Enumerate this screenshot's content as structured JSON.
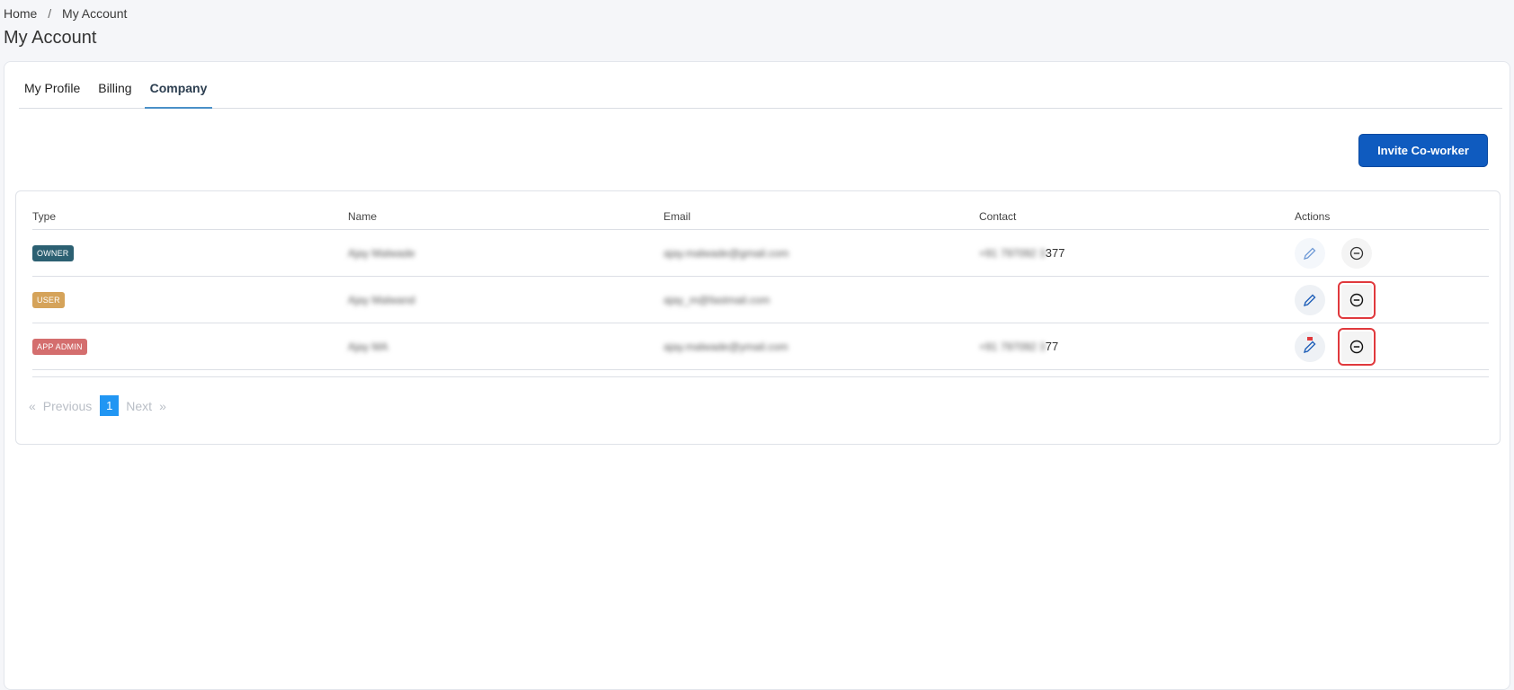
{
  "breadcrumb": {
    "home": "Home",
    "separator": "/",
    "current": "My Account"
  },
  "page_title": "My Account",
  "tabs": [
    {
      "label": "My Profile",
      "active": false
    },
    {
      "label": "Billing",
      "active": false
    },
    {
      "label": "Company",
      "active": true
    }
  ],
  "invite_button": "Invite Co-worker",
  "table": {
    "headers": [
      "Type",
      "Name",
      "Email",
      "Contact",
      "Actions"
    ],
    "rows": [
      {
        "type": "OWNER",
        "type_color": "#2c6072",
        "name": "Ajay Malwade",
        "email": "ajay.malwade@gmail.com",
        "contact_hidden": "+91 797092 3",
        "contact_visible": "377"
      },
      {
        "type": "USER",
        "type_color": "#d5a35a",
        "name": "Ajay Malwand",
        "email": "ajay_m@fastmail.com",
        "contact_hidden": "",
        "contact_visible": ""
      },
      {
        "type": "APP ADMIN",
        "type_color": "#d46e6e",
        "name": "Ajay MA",
        "email": "ajay.malwade@ymail.com",
        "contact_hidden": "+91 797092 3",
        "contact_visible": "77"
      }
    ]
  },
  "pagination": {
    "prev_arrow": "«",
    "prev": "Previous",
    "current_page": "1",
    "next": "Next",
    "next_arrow": "»"
  },
  "colors": {
    "primary": "#0f5bbf",
    "highlight": "#e0393d",
    "page_active": "#2196f3"
  }
}
